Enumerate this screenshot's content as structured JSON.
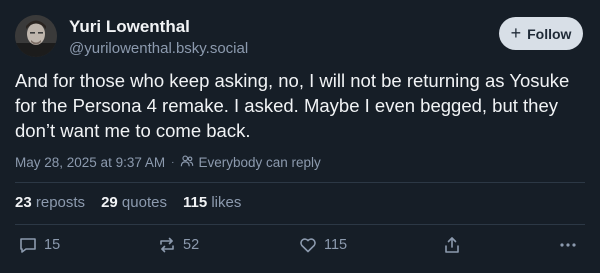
{
  "author": {
    "name": "Yuri Lowenthal",
    "handle": "@yurilowenthal.bsky.social"
  },
  "follow_button": {
    "label": "Follow"
  },
  "post": {
    "text": "And for those who keep asking, no, I will not be returning as Yosuke for the Persona 4 remake. I asked. Maybe I even begged, but they don’t want me to come back.",
    "timestamp": "May 28, 2025 at 9:37 AM",
    "separator": "·",
    "reply_setting": "Everybody can reply"
  },
  "stats": {
    "reposts_count": "23",
    "reposts_label": "reposts",
    "quotes_count": "29",
    "quotes_label": "quotes",
    "likes_count": "115",
    "likes_label": "likes"
  },
  "actions": {
    "replies": "15",
    "reposts": "52",
    "likes": "115"
  },
  "colors": {
    "background": "#161e27",
    "text_primary": "#f1f3f5",
    "text_secondary": "#8c9aae",
    "follow_button_bg": "#d8dfe7"
  }
}
